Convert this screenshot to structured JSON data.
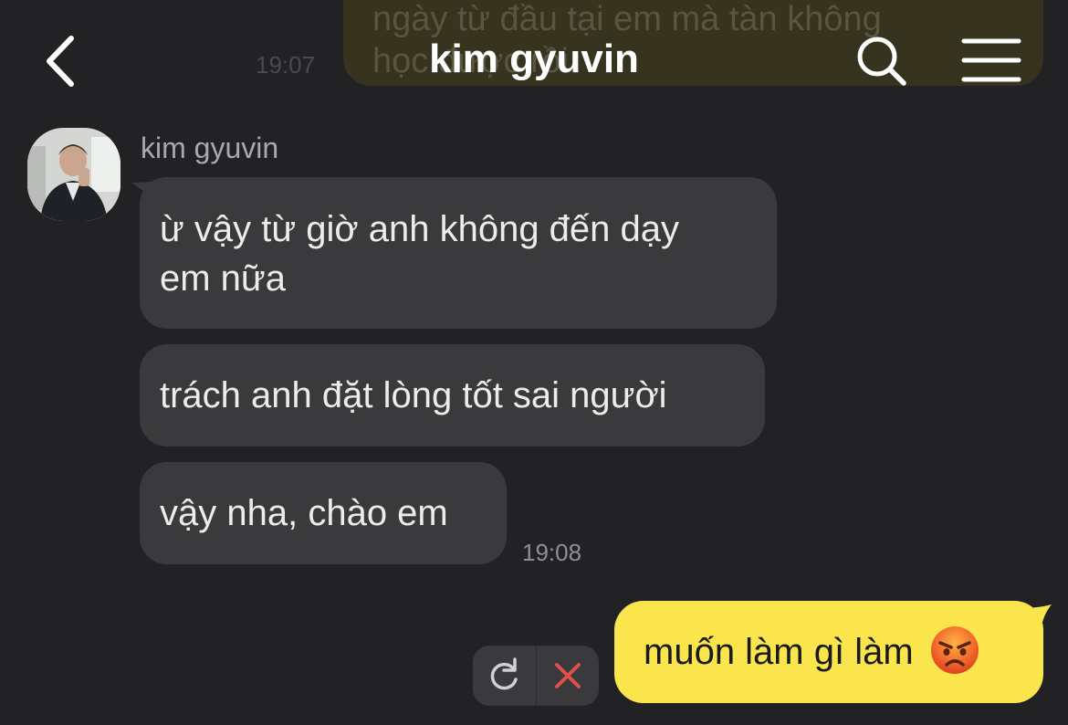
{
  "header": {
    "title": "kim gyuvin",
    "back_icon": "chevron-left-icon",
    "search_icon": "search-icon",
    "menu_icon": "hamburger-menu-icon"
  },
  "previous_message": {
    "line1": "ngày từ đầu tại em mà tàn không",
    "line2": "học được rồi",
    "time": "19:07"
  },
  "incoming": {
    "sender": "kim gyuvin",
    "messages": [
      {
        "line1": "ừ vậy từ giờ anh không đến dạy",
        "line2": "em nữa"
      },
      {
        "text": "trách anh đặt lòng tốt sai người"
      },
      {
        "text": "vậy nha, chào em"
      }
    ],
    "time": "19:08"
  },
  "outgoing": {
    "text": "muốn làm gì làm",
    "emoji": "angry-face-icon",
    "status": "failed",
    "retry_icon": "retry-icon",
    "cancel_icon": "close-icon"
  },
  "colors": {
    "background": "#222224",
    "incoming_bubble": "#3a3a3c",
    "outgoing_bubble": "#fae54d",
    "cancel_red": "#e0504a"
  }
}
